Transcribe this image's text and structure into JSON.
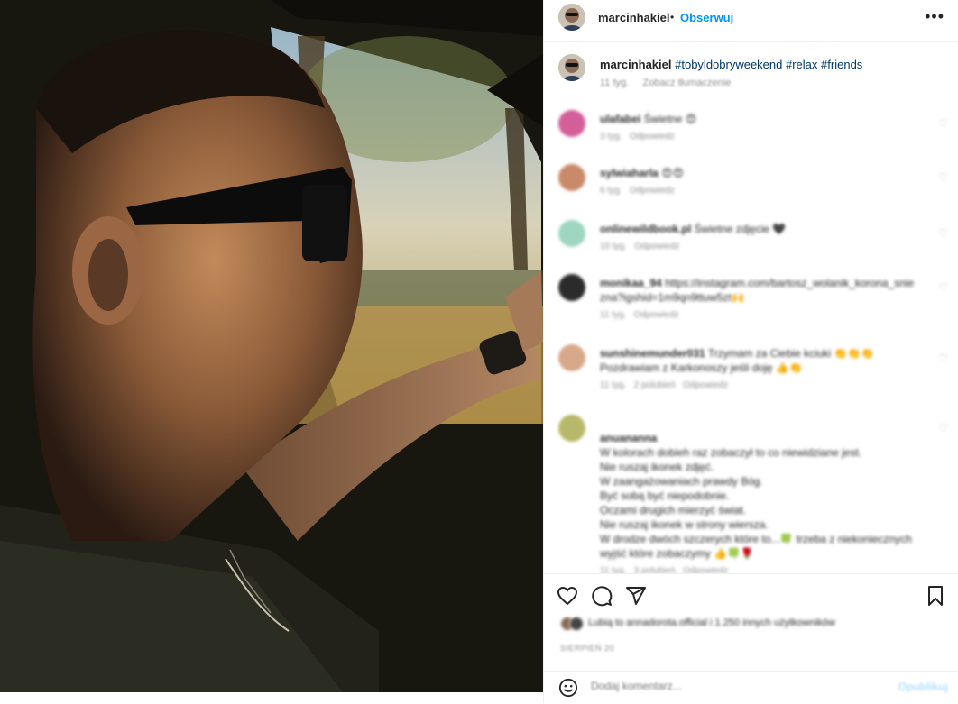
{
  "post": {
    "image_alt": "Man with sunglasses driving a car at sunset"
  },
  "header": {
    "username": "marcinhakiel",
    "separator": "•",
    "follow_label": "Obserwuj",
    "more_icon": "more-horizontal-icon",
    "more_label": "•••"
  },
  "caption": {
    "username": "marcinhakiel",
    "hashtags": [
      "#tobyldobryweekend",
      "#relax",
      "#friends"
    ],
    "time": "11 tyg.",
    "translate_label": "Zobacz tłumaczenie"
  },
  "comments": [
    {
      "user": "ulafabei",
      "text": "Świetne 😍",
      "time": "3 tyg.",
      "likes": "",
      "reply": "Odpowiedz",
      "avatar_color": "#d35f9a"
    },
    {
      "user": "sylwiaharla",
      "text": "😍😍",
      "time": "6 tyg.",
      "likes": "",
      "reply": "Odpowiedz",
      "avatar_color": "#c98a6a"
    },
    {
      "user": "onlinewildbook.pl",
      "text": "Świetne zdjęcie 🖤",
      "time": "10 tyg.",
      "likes": "",
      "reply": "Odpowiedz",
      "avatar_color": "#9ed6c0"
    },
    {
      "user": "monikaa_94",
      "text": "https://instagram.com/bartosz_wolanik_korona_sniezna?igshid=1m9qn9ttuw5zt🙌",
      "time": "11 tyg.",
      "likes": "",
      "reply": "Odpowiedz",
      "avatar_color": "#2b2b2b"
    },
    {
      "user": "sunshinemunder031",
      "text": "Trzymam za Ciebie kciuki 👏👏👏 Pozdrawiam z Karkonoszy jeśli doję 👍👏",
      "time": "11 tyg.",
      "likes": "2 polubień",
      "reply": "Odpowiedz",
      "avatar_color": "#d7a88a"
    },
    {
      "user": "anuananna",
      "text": "W kolorach dobieh raz zobaczył to co niewidziane jest.\nNie ruszaj ikonek zdjęć.\nW zaangażowaniach prawdy Bóg.\nByć sobą być niepodobnie.\nOczami drugich mierzyć świat.\nNie ruszaj ikonek w strony wiersza.\nW drodze dwóch szczerych które to...🍀 trzeba z niekoniecznych wyjść które zobaczymy 👍🍀🌹",
      "time": "11 tyg.",
      "likes": "3 polubień",
      "reply": "Odpowiedz",
      "avatar_color": "#b8b86a"
    }
  ],
  "actions": {
    "like_icon": "heart-icon",
    "comment_icon": "comment-icon",
    "share_icon": "send-icon",
    "save_icon": "bookmark-icon"
  },
  "likes": {
    "text": "Lubią to annadorota.official i 1.250 innych użytkowników"
  },
  "date": "SIERPIEŃ 20",
  "add_comment": {
    "placeholder": "Dodaj komentarz...",
    "post_label": "Opublikuj",
    "emoji_icon": "emoji-icon"
  }
}
